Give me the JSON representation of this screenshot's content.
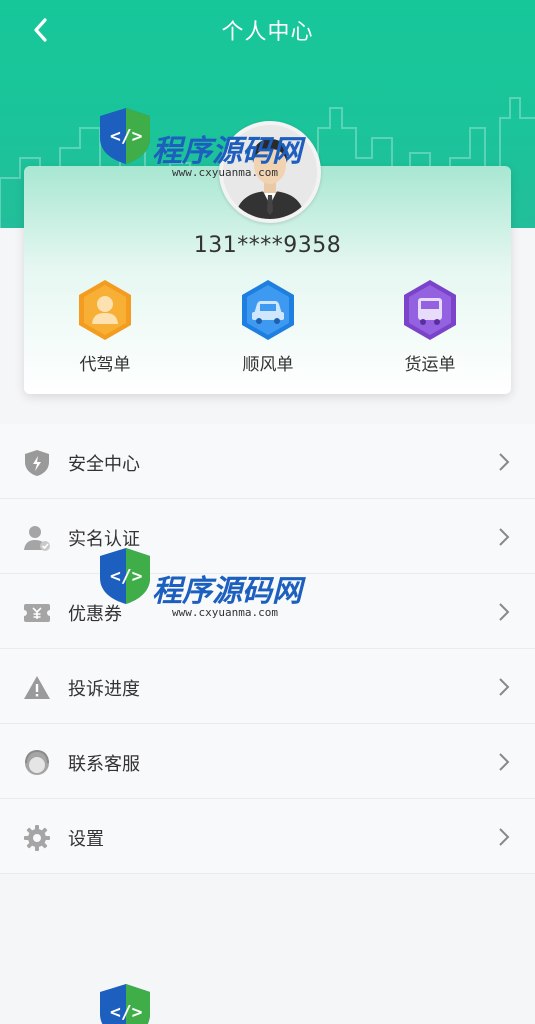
{
  "header": {
    "title": "个人中心",
    "back_icon": "chevron-left-icon"
  },
  "profile": {
    "phone": "131****9358",
    "avatar_icon": "user-avatar-icon"
  },
  "orders": [
    {
      "label": "代驾单",
      "icon": "driver-icon",
      "color": "#f5a623"
    },
    {
      "label": "顺风单",
      "icon": "car-icon",
      "color": "#2f8fe8"
    },
    {
      "label": "货运单",
      "icon": "truck-icon",
      "color": "#8a5ad8"
    }
  ],
  "menu": [
    {
      "label": "安全中心",
      "icon": "shield-icon"
    },
    {
      "label": "实名认证",
      "icon": "verified-user-icon"
    },
    {
      "label": "优惠券",
      "icon": "coupon-icon"
    },
    {
      "label": "投诉进度",
      "icon": "warning-icon"
    },
    {
      "label": "联系客服",
      "icon": "customer-service-icon"
    },
    {
      "label": "设置",
      "icon": "gear-icon"
    }
  ],
  "watermark": {
    "brand": "程序源码网",
    "url": "www.cxyuanma.com"
  },
  "colors": {
    "header_start": "#16c79a",
    "header_end": "#23be9b",
    "menu_bg": "#f8f9fa"
  }
}
